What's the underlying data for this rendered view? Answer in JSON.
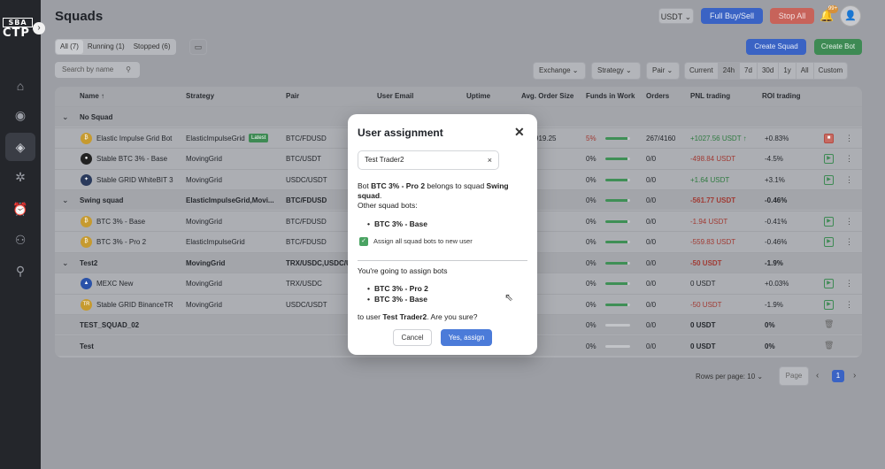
{
  "logo": {
    "top": "SBA",
    "bottom": "CTP"
  },
  "sidebar": {
    "collapse_icon": "›",
    "items": [
      {
        "name": "home",
        "icon": "⌂"
      },
      {
        "name": "bots",
        "icon": "◉"
      },
      {
        "name": "squads",
        "icon": "◈"
      },
      {
        "name": "settings",
        "icon": "✲"
      },
      {
        "name": "alerts",
        "icon": "⏰"
      },
      {
        "name": "users-admin",
        "icon": "⚇"
      },
      {
        "name": "profile",
        "icon": "⚲"
      }
    ]
  },
  "header": {
    "title": "Squads",
    "currency": "USDT ⌄",
    "full_buy_sell": "Full Buy/Sell",
    "stop_all": "Stop All",
    "notifications_badge": "99+",
    "bell_icon": "🔔",
    "avatar_icon": "👤"
  },
  "toolbar": {
    "tabs": [
      {
        "label": "All (7)"
      },
      {
        "label": "Running (1)"
      },
      {
        "label": "Stopped (6)"
      }
    ],
    "calendar_icon": "▭",
    "create_squad": "Create Squad",
    "create_bot": "Create Bot",
    "search_placeholder": "Search by name",
    "search_icon": "⚲",
    "exchange": "Exchange ⌄",
    "strategy": "Strategy ⌄",
    "pair": "Pair ⌄",
    "periods": [
      {
        "label": "Current"
      },
      {
        "label": "24h"
      },
      {
        "label": "7d"
      },
      {
        "label": "30d"
      },
      {
        "label": "1y"
      },
      {
        "label": "All"
      },
      {
        "label": "Custom"
      }
    ]
  },
  "table": {
    "headers": {
      "name": "Name ↑",
      "strategy": "Strategy",
      "pair": "Pair",
      "user_email": "User Email",
      "uptime": "Uptime",
      "avg_order": "Avg. Order Size",
      "funds": "Funds in Work",
      "orders": "Orders",
      "pnl": "PNL trading",
      "roi": "ROI trading"
    },
    "latest_badge": "Latest",
    "rows": [
      {
        "group": true,
        "name": "No Squad",
        "strategy": "",
        "pair": "",
        "avg": "",
        "funds": "",
        "orders": "",
        "pnl": "",
        "roi": ""
      },
      {
        "group": false,
        "name": "Elastic Impulse Grid Bot",
        "strategy": "ElasticImpulseGrid",
        "pair": "BTC/FDUSD",
        "avg": "919.25",
        "funds": "5%",
        "funds_pct": 0.9,
        "orders": "267/4160",
        "pnl": "+1027.56 USDT ↑",
        "roi": "+0.83%",
        "icon": "₿",
        "icon_color": "#c69a2f"
      },
      {
        "group": false,
        "name": "Stable BTC 3% - Base",
        "strategy": "MovingGrid",
        "pair": "BTC/USDT",
        "avg": "",
        "funds": "0%",
        "funds_pct": 0.9,
        "orders": "0/0",
        "pnl": "-498.84 USDT",
        "roi": "-4.5%",
        "icon": "●",
        "icon_color": "#222"
      },
      {
        "group": false,
        "name": "Stable GRID WhiteBIT 3",
        "strategy": "MovingGrid",
        "pair": "USDC/USDT",
        "avg": "",
        "funds": "0%",
        "funds_pct": 0.9,
        "orders": "0/0",
        "pnl": "+1.64 USDT",
        "roi": "+3.1%",
        "icon": "✦",
        "icon_color": "#2a3a5c"
      },
      {
        "group": true,
        "name": "Swing squad",
        "strategy": "ElasticImpulseGrid,Movi...",
        "pair": "BTC/FDUSD",
        "avg": "",
        "funds": "0%",
        "funds_pct": 0.9,
        "orders": "0/0",
        "pnl": "-561.77 USDT",
        "roi": "-0.46%"
      },
      {
        "group": false,
        "name": "BTC 3% - Base",
        "strategy": "MovingGrid",
        "pair": "BTC/FDUSD",
        "avg": "",
        "funds": "0%",
        "funds_pct": 0.9,
        "orders": "0/0",
        "pnl": "-1.94 USDT",
        "roi": "-0.41%",
        "icon": "₿",
        "icon_color": "#c69a2f"
      },
      {
        "group": false,
        "name": "BTC 3% - Pro 2",
        "strategy": "ElasticImpulseGrid",
        "pair": "BTC/FDUSD",
        "avg": "",
        "funds": "0%",
        "funds_pct": 0.9,
        "orders": "0/0",
        "pnl": "-559.83 USDT",
        "roi": "-0.46%",
        "icon": "₿",
        "icon_color": "#c69a2f"
      },
      {
        "group": true,
        "name": "Test2",
        "strategy": "MovingGrid",
        "pair": "TRX/USDC,USDC/U...",
        "avg": "",
        "funds": "0%",
        "funds_pct": 0.9,
        "orders": "0/0",
        "pnl": "-50 USDT",
        "roi": "-1.9%"
      },
      {
        "group": false,
        "name": "MEXC New",
        "strategy": "MovingGrid",
        "pair": "TRX/USDC",
        "avg": "",
        "funds": "0%",
        "funds_pct": 0.9,
        "orders": "0/0",
        "pnl": "0 USDT",
        "roi": "+0.03%",
        "icon": "▲",
        "icon_color": "#2a52a8"
      },
      {
        "group": false,
        "name": "Stable GRID BinanceTR",
        "strategy": "MovingGrid",
        "pair": "USDC/USDT",
        "avg": "",
        "funds": "0%",
        "funds_pct": 0.9,
        "orders": "0/0",
        "pnl": "-50 USDT",
        "roi": "-1.9%",
        "icon": "TR",
        "icon_color": "#c69a2f"
      },
      {
        "group": true,
        "name": "TEST_SQUAD_02",
        "strategy": "",
        "pair": "",
        "avg": "",
        "funds": "0%",
        "funds_pct": 0,
        "orders": "0/0",
        "pnl": "0 USDT",
        "roi": "0%"
      },
      {
        "group": true,
        "name": "Test",
        "strategy": "",
        "pair": "",
        "avg": "",
        "funds": "0%",
        "funds_pct": 0,
        "orders": "0/0",
        "pnl": "0 USDT",
        "roi": "0%"
      }
    ]
  },
  "pagination": {
    "rows_per_page": "Rows per page:  10 ⌄",
    "page_placeholder": "Page",
    "current_page": "1",
    "prev_icon": "‹",
    "next_icon": "›"
  },
  "modal": {
    "title": "User assignment",
    "close_icon": "✕",
    "selected_user": "Test Trader2",
    "clear_icon": "×",
    "line1_a": "Bot ",
    "line1_bot": "BTC 3% - Pro 2",
    "line1_b": " belongs to squad ",
    "line1_squad": "Swing squad",
    "other_bots_label": "Other squad bots:",
    "other_bots": [
      "BTC 3% - Base"
    ],
    "checkbox_label": "Assign all squad bots to new user",
    "going_label": "You're going to assign bots",
    "assign_bots": [
      "BTC 3% - Pro 2",
      "BTC 3% - Base"
    ],
    "to_user_a": "to user ",
    "to_user_name": "Test Trader2",
    "to_user_b": ". Are you sure?",
    "cancel": "Cancel",
    "confirm": "Yes, assign"
  }
}
